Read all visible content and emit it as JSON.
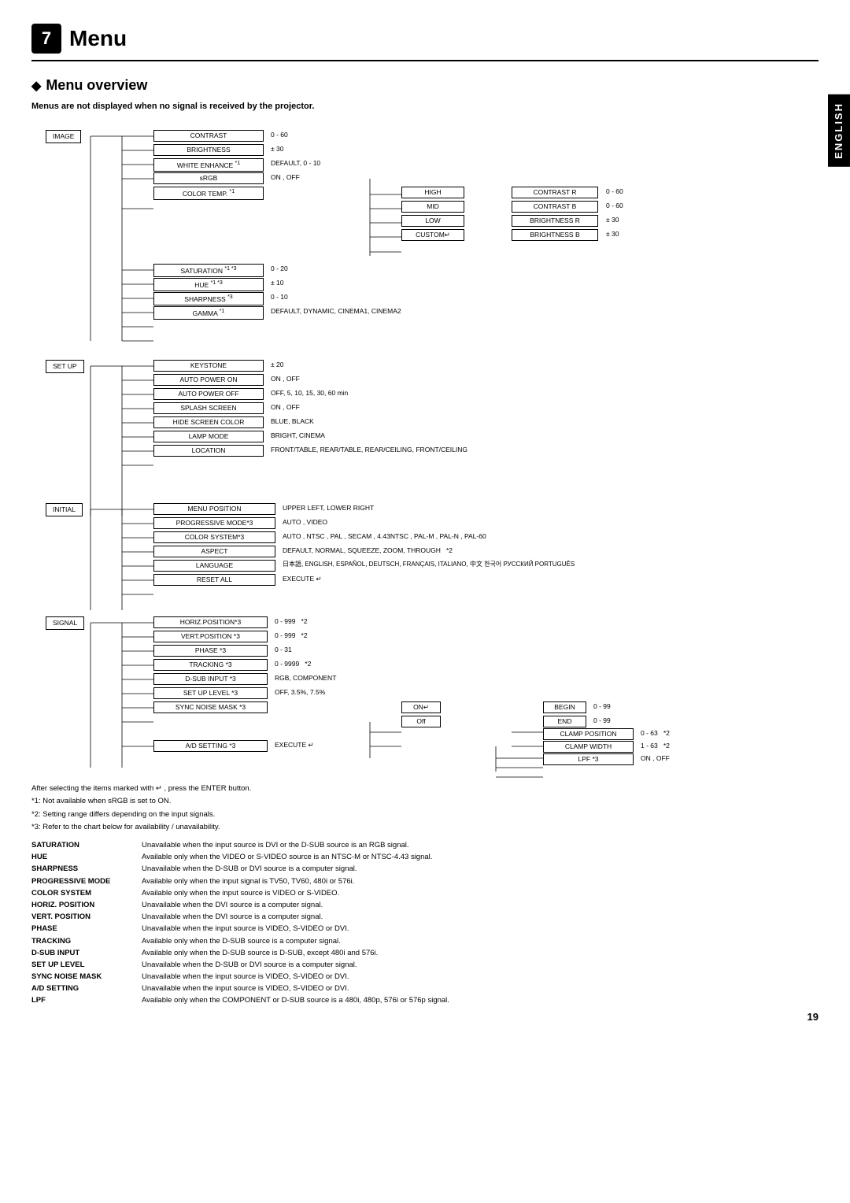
{
  "chapter": {
    "number": "7",
    "title": "Menu"
  },
  "section": {
    "title": "Menu overview",
    "subtitle": "Menus are not displayed when no signal is received by the projector."
  },
  "side_tab": "ENGLISH",
  "page_number": "19",
  "categories": [
    {
      "id": "image",
      "label": "IMAGE"
    },
    {
      "id": "setup",
      "label": "SET UP"
    },
    {
      "id": "initial",
      "label": "INITIAL"
    },
    {
      "id": "signal",
      "label": "SIGNAL"
    }
  ],
  "image_items": [
    {
      "label": "CONTRAST",
      "value": "0 - 60"
    },
    {
      "label": "BRIGHTNESS",
      "value": "± 30"
    },
    {
      "label": "WHITE ENHANCE *1",
      "value": "DEFAULT, 0 - 10"
    },
    {
      "label": "sRGB",
      "value": "ON , OFF"
    },
    {
      "label": "COLOR TEMP. *1",
      "sub": [
        "HIGH",
        "MID",
        "LOW",
        "CUSTOM↵"
      ],
      "values": [
        "",
        "",
        "",
        ""
      ]
    },
    {
      "label": "SATURATION *1 *3",
      "value": "0 - 20"
    },
    {
      "label": "HUE *1 *3",
      "value": "± 10"
    },
    {
      "label": "SHARPNESS *3",
      "value": "0 - 10"
    },
    {
      "label": "GAMMA *1",
      "value": "DEFAULT, DYNAMIC, CINEMA1, CINEMA2"
    }
  ],
  "color_temp_right": [
    {
      "label": "CONTRAST R",
      "value": "0 - 60"
    },
    {
      "label": "CONTRAST B",
      "value": "0 - 60"
    },
    {
      "label": "BRIGHTNESS R",
      "value": "± 30"
    },
    {
      "label": "BRIGHTNESS B",
      "value": "± 30"
    }
  ],
  "setup_items": [
    {
      "label": "KEYSTONE",
      "value": "± 20"
    },
    {
      "label": "AUTO POWER ON",
      "value": "ON , OFF"
    },
    {
      "label": "AUTO POWER OFF",
      "value": "OFF, 5, 10, 15, 30, 60 min"
    },
    {
      "label": "SPLASH SCREEN",
      "value": "ON , OFF"
    },
    {
      "label": "HIDE SCREEN COLOR",
      "value": "BLUE, BLACK"
    },
    {
      "label": "LAMP MODE",
      "value": "BRIGHT, CINEMA"
    },
    {
      "label": "LOCATION",
      "value": "FRONT/TABLE, REAR/TABLE, REAR/CEILING, FRONT/CEILING"
    }
  ],
  "initial_items": [
    {
      "label": "MENU POSITION",
      "value": "UPPER LEFT, LOWER RIGHT"
    },
    {
      "label": "PROGRESSIVE MODE*3",
      "value": "AUTO , VIDEO"
    },
    {
      "label": "COLOR SYSTEM*3",
      "value": "AUTO , NTSC , PAL , SECAM , 4.43NTSC , PAL-M , PAL-N , PAL-60"
    },
    {
      "label": "ASPECT",
      "value": "DEFAULT, NORMAL, SQUEEZE, ZOOM, THROUGH  *2"
    },
    {
      "label": "LANGUAGE",
      "value": "日本語, ENGLISH, ESPAÑOL, DEUTSCH, FRANÇAIS, ITALIANO, 中文 한국어 РУССКИЙ PORTUGUÊS"
    },
    {
      "label": "RESET ALL",
      "value": "EXECUTE ↵"
    }
  ],
  "signal_items": [
    {
      "label": "HORIZ.POSITION*3",
      "value": "0 - 999",
      "note": "*2"
    },
    {
      "label": "VERT.POSITION *3",
      "value": "0 - 999",
      "note": "*2"
    },
    {
      "label": "PHASE *3",
      "value": "0 - 31"
    },
    {
      "label": "TRACKING *3",
      "value": "0 - 9999",
      "note": "*2"
    },
    {
      "label": "D-SUB INPUT *3",
      "value": "RGB, COMPONENT"
    },
    {
      "label": "SET UP LEVEL *3",
      "value": "OFF, 3.5%, 7.5%"
    },
    {
      "label": "SYNC NOISE MASK *3",
      "sub_on": "ON↵",
      "sub_off": "Off",
      "begin": "0 - 99",
      "end": "0 - 99"
    },
    {
      "label": "A/D SETTING *3",
      "value": "EXECUTE ↵",
      "right": [
        {
          "label": "CLAMP POSITION",
          "value": "0 - 63",
          "note": "*2"
        },
        {
          "label": "CLAMP WIDTH",
          "value": "1 - 63",
          "note": "*2"
        },
        {
          "label": "LPF *3",
          "value": "ON , OFF"
        }
      ]
    }
  ],
  "footnotes": [
    "After selecting the items marked with ↵ , press the ENTER button.",
    "*1:   Not available when sRGB is set to ON.",
    "*2:   Setting range differs depending on the input signals.",
    "*3:   Refer to the chart below for availability / unavailability."
  ],
  "availability_table": [
    {
      "label": "SATURATION",
      "desc": "Unavailable when the input source is DVI or the D-SUB source is an RGB signal."
    },
    {
      "label": "HUE",
      "desc": "Available only when the VIDEO or S-VIDEO source is an NTSC-M or NTSC-4.43 signal."
    },
    {
      "label": "SHARPNESS",
      "desc": "Unavailable when the D-SUB or DVI source is a computer signal."
    },
    {
      "label": "PROGRESSIVE MODE",
      "desc": "Available only when the input signal is TV50, TV60, 480i or 576i."
    },
    {
      "label": "COLOR SYSTEM",
      "desc": "Available only when the input source is VIDEO or S-VIDEO."
    },
    {
      "label": "HORIZ. POSITION",
      "desc": "Unavailable when the DVI source is a computer signal."
    },
    {
      "label": "VERT. POSITION",
      "desc": "Unavailable when the DVI source is a computer signal."
    },
    {
      "label": "PHASE",
      "desc": "Unavailable when the input source is VIDEO, S-VIDEO or DVI."
    },
    {
      "label": "TRACKING",
      "desc": "Available only when the D-SUB source is a computer signal."
    },
    {
      "label": "D-SUB INPUT",
      "desc": "Available only when the D-SUB source is D-SUB, except 480i and 576i."
    },
    {
      "label": "SET UP LEVEL",
      "desc": "Unavailable when the D-SUB or DVI source is a computer signal."
    },
    {
      "label": "SYNC NOISE MASK",
      "desc": "Unavailable when the input source is VIDEO, S-VIDEO or DVI."
    },
    {
      "label": "A/D SETTING",
      "desc": "Unavailable when the input source is VIDEO, S-VIDEO or DVI."
    },
    {
      "label": "LPF",
      "desc": "Available only when the COMPONENT or D-SUB source is a 480i, 480p, 576i or 576p signal."
    }
  ]
}
